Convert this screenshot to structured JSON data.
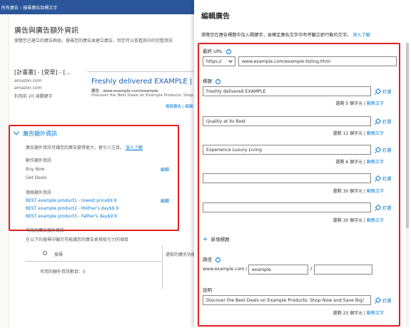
{
  "background": {
    "topbar_text": "所有廣告 › 搜尋廣告目標文字",
    "title": "廣告與廣告額外資訊",
    "description": "瀏覽您已建立的廣告群組，搜尋您的廣告並建立廣告，但您可以查看其中的完整資訊",
    "breadcrumb": "[計畫書] - [受眾] - [...",
    "lines": [
      "amazon.com",
      "amazon.com",
      "利用前 20 項關鍵字"
    ],
    "preview": {
      "title": "Freshly delivered EXAMPLE | Quality",
      "url": "廣告 · www.example.com/example",
      "desc": "Discover the Best Deals on Example Products: Shop Now"
    },
    "copy_link": "複製廣告 | 編輯",
    "extensions": {
      "heading": "廣告額外資訊",
      "intro": "廣告額外資訊可讓您的廣告變得更大，更引人注目。",
      "intro_link": "深入了解",
      "callout_label": "動作額外資訊",
      "callout_edit": "編輯",
      "callouts": [
        "Buy Now",
        "Get Deals"
      ],
      "price_label": "價格額外資訊",
      "price_edit": "編輯",
      "prices": [
        "BEST example product1 - lowest price$9.9",
        "BEST example product2 - Mother's day$9.9",
        "BEST example product3 - Father's day$9.9"
      ]
    },
    "more_title": "可能的廣告額外資訊",
    "more_desc": "在以下的搜尋中顯示可能讓您的廣告更具吸引力的項目",
    "search_placeholder": "搜尋",
    "available_count": "可用的額外資訊數目：0",
    "right_note": "選取的擴充功能將顯示於此"
  },
  "panel": {
    "title": "編輯廣告",
    "intro": "瀏覽您在廣告標題中加入關鍵字，並確定廣告文字中有呼籲立即行動的文字。",
    "intro_link": "深入了解",
    "final_url_label": "最終 URL",
    "protocol": "https://",
    "final_url": "www.example.com/example-listing.html",
    "headlines_label": "標題",
    "pin_label": "釘選",
    "dynamic_text": "動態文字",
    "headlines": [
      {
        "value": "Freshly delivered EXAMPLE",
        "remaining": "還剩 5 個字元 |"
      },
      {
        "value": "Quality at its Best",
        "remaining": "還剩 11 個字元 |"
      },
      {
        "value": "Experience Luxury Living",
        "remaining": "還剩 6 個字元 |"
      },
      {
        "value": "",
        "remaining": "還剩 30 個字元 |"
      },
      {
        "value": "",
        "remaining": "還剩 30 個字元 |"
      }
    ],
    "add_headline": "新增標題",
    "path_label": "路徑",
    "path_prefix": "www.example.com /",
    "path1": "example",
    "path2": "",
    "description_label": "說明",
    "description": "Discover the Best Deals on Example Products: Shop Now and Save Big!",
    "description_remaining": "還剩 23 個字元 |"
  }
}
